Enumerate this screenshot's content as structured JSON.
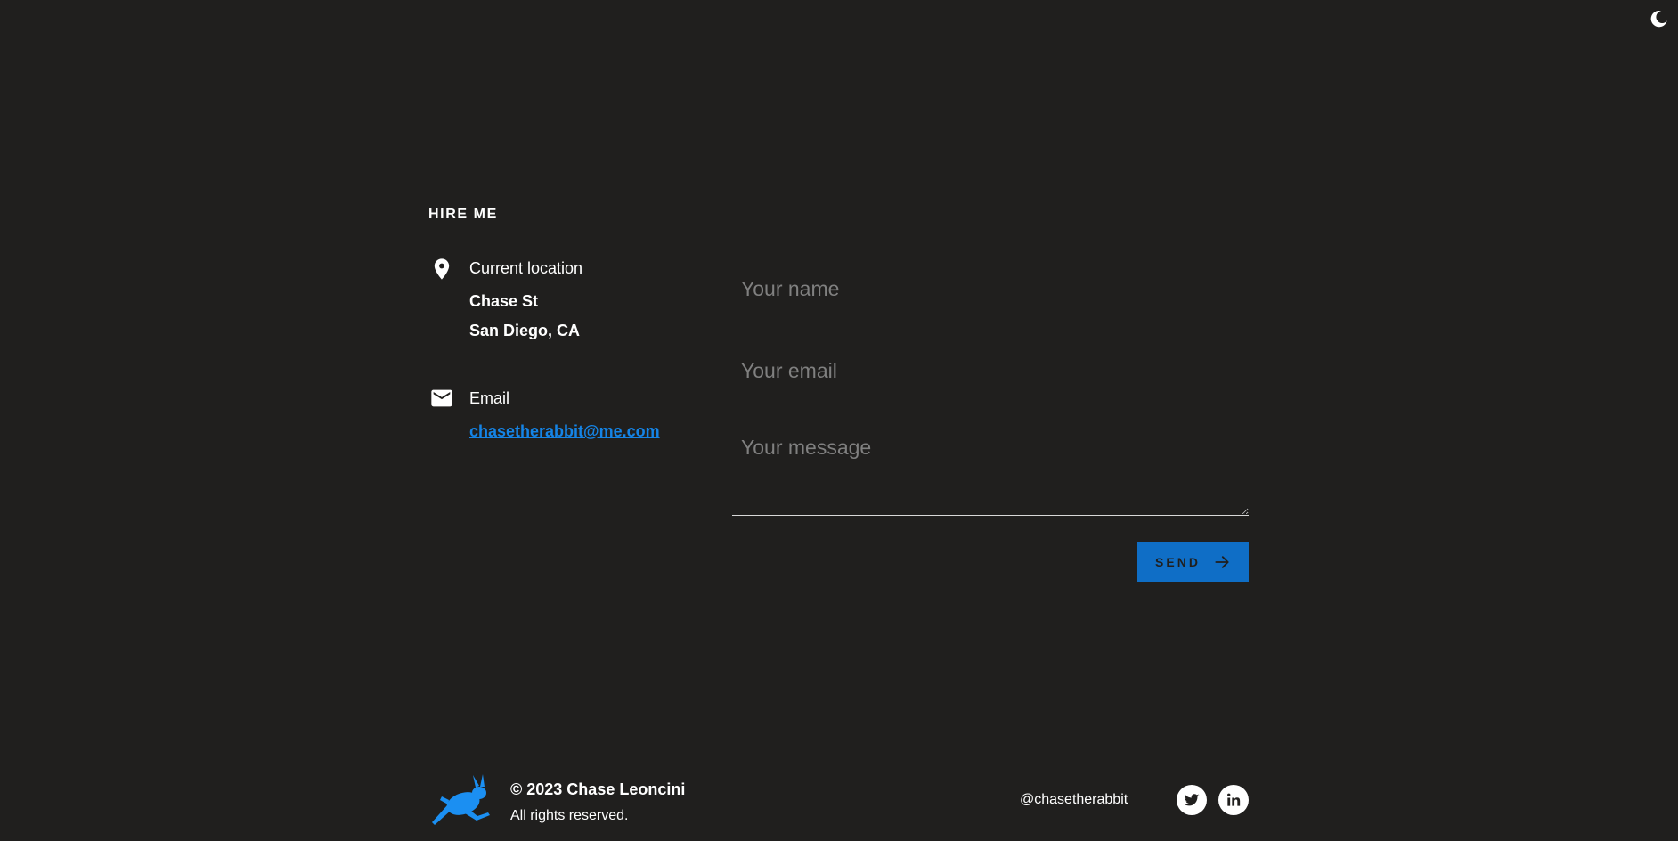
{
  "contact": {
    "section_title": "HIRE ME",
    "location_label": "Current location",
    "address_line1": "Chase St",
    "address_line2": "San Diego, CA",
    "email_label": "Email",
    "email": "chasetherabbit@me.com"
  },
  "form": {
    "name_placeholder": "Your name",
    "email_placeholder": "Your email",
    "message_placeholder": "Your message",
    "send_label": "SEND"
  },
  "footer": {
    "copyright": "© 2023 Chase Leoncini",
    "rights": "All rights reserved.",
    "handle": "@chasetherabbit"
  },
  "colors": {
    "background": "#201f1e",
    "accent": "#1584e6",
    "button": "#0f6ec6"
  },
  "icons": {
    "theme_toggle": "moon-icon",
    "location": "map-pin-icon",
    "email": "envelope-icon",
    "send": "arrow-right-icon",
    "logo": "rabbit-logo",
    "social": [
      "twitter-icon",
      "linkedin-icon"
    ]
  }
}
